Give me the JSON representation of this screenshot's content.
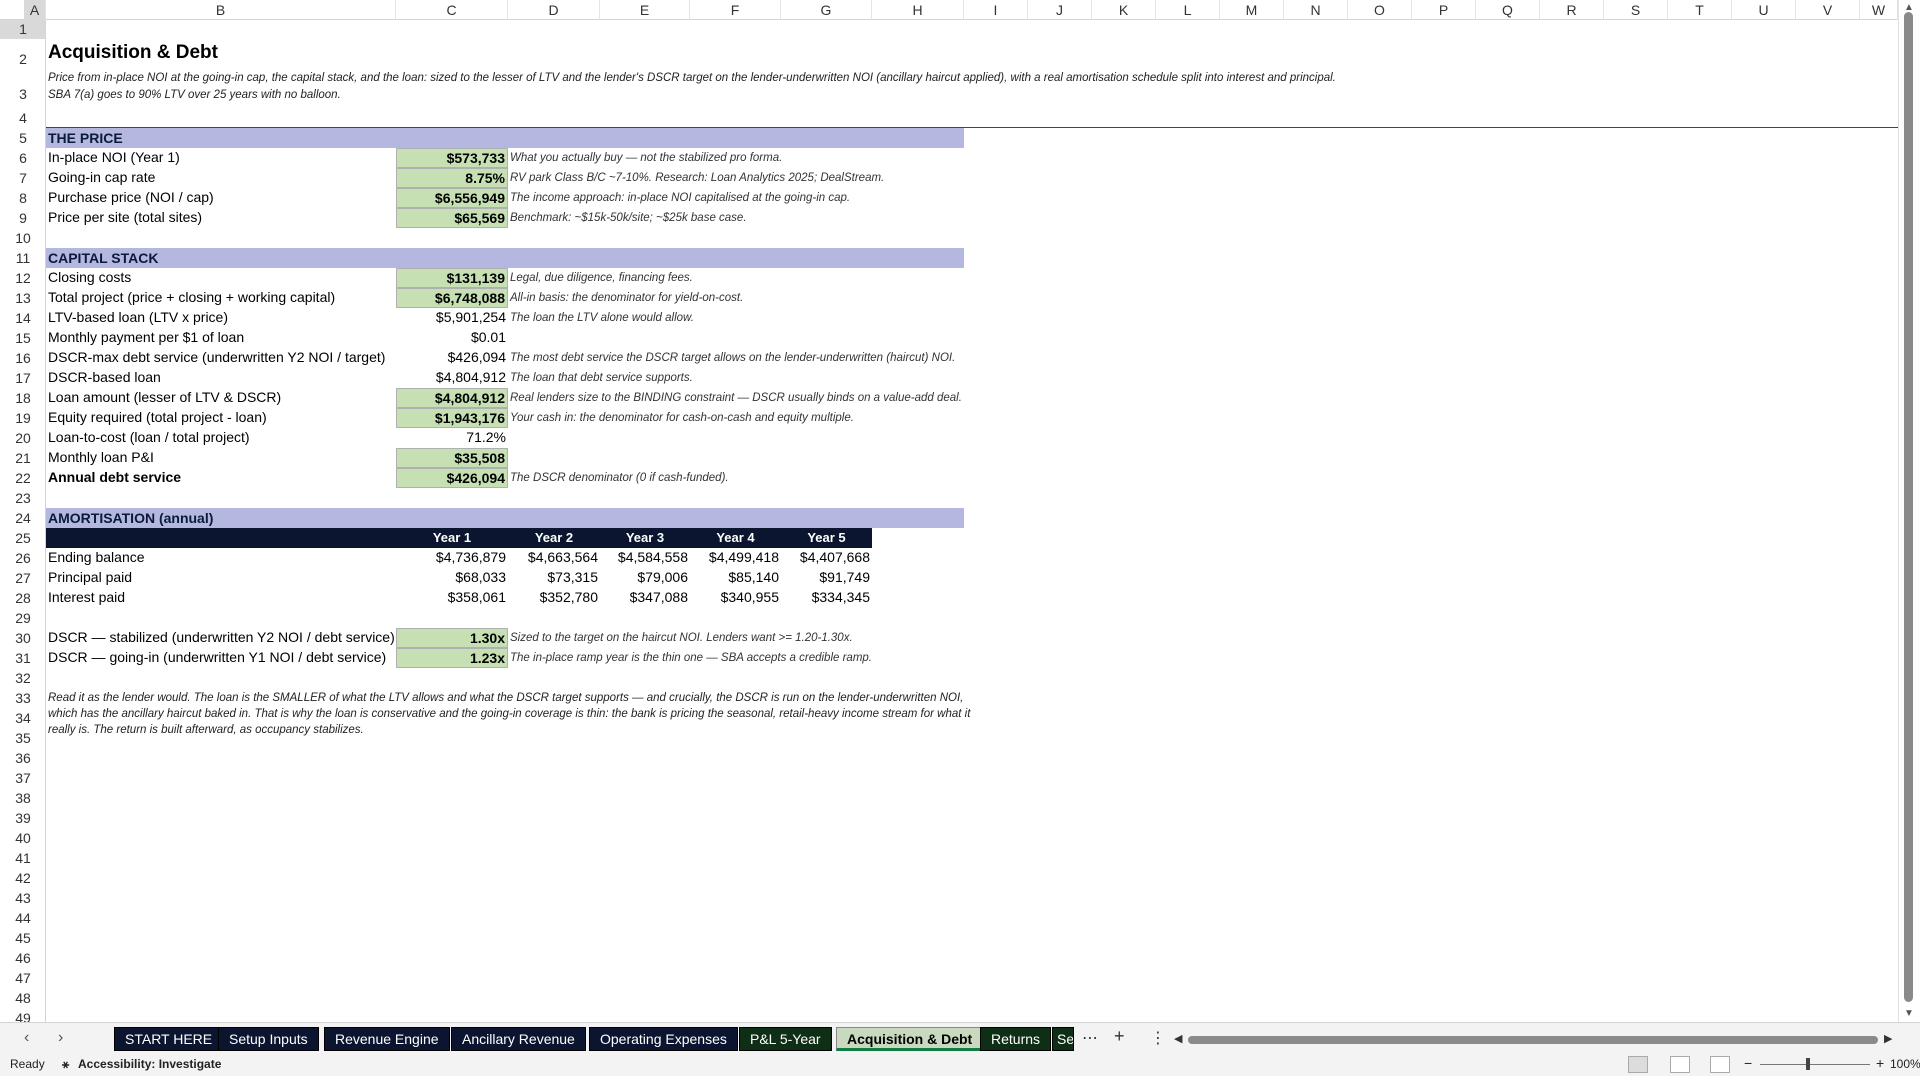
{
  "columns": [
    "A",
    "B",
    "C",
    "D",
    "E",
    "F",
    "G",
    "H",
    "I",
    "J",
    "K",
    "L",
    "M",
    "N",
    "O",
    "P",
    "Q",
    "R",
    "S",
    "T",
    "U",
    "V",
    "W"
  ],
  "rows": [
    "1",
    "2",
    "3",
    "4",
    "5",
    "6",
    "7",
    "8",
    "9",
    "10",
    "11",
    "12",
    "13",
    "14",
    "15",
    "16",
    "17",
    "18",
    "19",
    "20",
    "21",
    "22",
    "23",
    "24",
    "25",
    "26",
    "27",
    "28",
    "29",
    "30",
    "31",
    "32",
    "33",
    "34",
    "35",
    "36",
    "37",
    "38",
    "39",
    "40",
    "41",
    "42",
    "43",
    "44",
    "45",
    "46",
    "47",
    "48",
    "49"
  ],
  "sheet": {
    "title": "Acquisition & Debt",
    "subtitle": "Price from in-place NOI at the going-in cap, the capital stack, and the loan: sized to the lesser of LTV and the lender's DSCR target on the lender-underwritten NOI (ancillary haircut applied), with a real amortisation schedule split into interest and principal. SBA 7(a) goes to 90% LTV over 25 years with no balloon.",
    "price": {
      "header": "THE PRICE",
      "rows": [
        {
          "label": "In-place NOI (Year 1)",
          "value": "$573,733",
          "note": "What you actually buy — not the stabilized pro forma."
        },
        {
          "label": "Going-in cap rate",
          "value": "8.75%",
          "note": "RV park Class B/C ~7-10%. Research: Loan Analytics 2025; DealStream."
        },
        {
          "label": "Purchase price (NOI / cap)",
          "value": "$6,556,949",
          "note": "The income approach: in-place NOI capitalised at the going-in cap."
        },
        {
          "label": "Price per site (total sites)",
          "value": "$65,569",
          "note": "Benchmark: ~$15k-50k/site; ~$25k base case."
        }
      ]
    },
    "capital": {
      "header": "CAPITAL STACK",
      "rows": [
        {
          "label": "Closing costs",
          "value": "$131,139",
          "note": "Legal, due diligence, financing fees."
        },
        {
          "label": "Total project (price + closing + working capital)",
          "value": "$6,748,088",
          "note": "All-in basis: the denominator for yield-on-cost."
        },
        {
          "label": "LTV-based loan (LTV x price)",
          "value": "$5,901,254",
          "note": "The loan the LTV alone would allow."
        },
        {
          "label": "Monthly payment per $1 of loan",
          "value": "$0.01",
          "note": ""
        },
        {
          "label": "DSCR-max debt service (underwritten Y2 NOI / target)",
          "value": "$426,094",
          "note": "The most debt service the DSCR target allows on the lender-underwritten (haircut) NOI."
        },
        {
          "label": "DSCR-based loan",
          "value": "$4,804,912",
          "note": "The loan that debt service supports."
        },
        {
          "label": "Loan amount (lesser of LTV & DSCR)",
          "value": "$4,804,912",
          "note": "Real lenders size to the BINDING constraint — DSCR usually binds on a value-add deal."
        },
        {
          "label": "Equity required (total project - loan)",
          "value": "$1,943,176",
          "note": "Your cash in: the denominator for cash-on-cash and equity multiple."
        },
        {
          "label": "Loan-to-cost (loan / total project)",
          "value": "71.2%",
          "note": ""
        },
        {
          "label": "Monthly loan P&I",
          "value": "$35,508",
          "note": ""
        },
        {
          "label": "Annual debt service",
          "value": "$426,094",
          "note": "The DSCR denominator (0 if cash-funded)."
        }
      ]
    },
    "amort": {
      "header": "AMORTISATION (annual)",
      "years": [
        "Year 1",
        "Year 2",
        "Year 3",
        "Year 4",
        "Year 5"
      ],
      "rows": [
        {
          "label": "Ending balance",
          "values": [
            "$4,736,879",
            "$4,663,564",
            "$4,584,558",
            "$4,499,418",
            "$4,407,668"
          ]
        },
        {
          "label": "Principal paid",
          "values": [
            "$68,033",
            "$73,315",
            "$79,006",
            "$85,140",
            "$91,749"
          ]
        },
        {
          "label": "Interest paid",
          "values": [
            "$358,061",
            "$352,780",
            "$347,088",
            "$340,955",
            "$334,345"
          ]
        }
      ]
    },
    "dscr": [
      {
        "label": "DSCR — stabilized (underwritten Y2 NOI / debt service)",
        "value": "1.30x",
        "note": "Sized to the target on the haircut NOI. Lenders want >= 1.20-1.30x."
      },
      {
        "label": "DSCR — going-in (underwritten Y1 NOI / debt service)",
        "value": "1.23x",
        "note": "The in-place ramp year is the thin one — SBA accepts a credible ramp."
      }
    ],
    "closing_note": "Read it as the lender would. The loan is the SMALLER of what the LTV allows and what the DSCR target supports — and crucially, the DSCR is run on the lender-underwritten NOI, which has the ancillary haircut baked in. That is why the loan is conservative and the going-in coverage is thin: the bank is pricing the seasonal, retail-heavy income stream for what it really is. The return is built afterward, as occupancy stabilizes."
  },
  "tabs": [
    {
      "label": "START HERE"
    },
    {
      "label": "Setup Inputs"
    },
    {
      "label": "Revenue Engine"
    },
    {
      "label": "Ancillary Revenue"
    },
    {
      "label": "Operating Expenses"
    },
    {
      "label": "P&L 5-Year"
    },
    {
      "label": "Acquisition & Debt"
    },
    {
      "label": "Returns"
    },
    {
      "label": "Se"
    }
  ],
  "status": {
    "ready": "Ready",
    "accessibility": "Accessibility: Investigate",
    "zoom": "100%"
  },
  "colors": {
    "band": "#b4b8e0",
    "input_green": "#c6e0b4",
    "year_bar": "#0b1530",
    "excel_green": "#107c41"
  }
}
